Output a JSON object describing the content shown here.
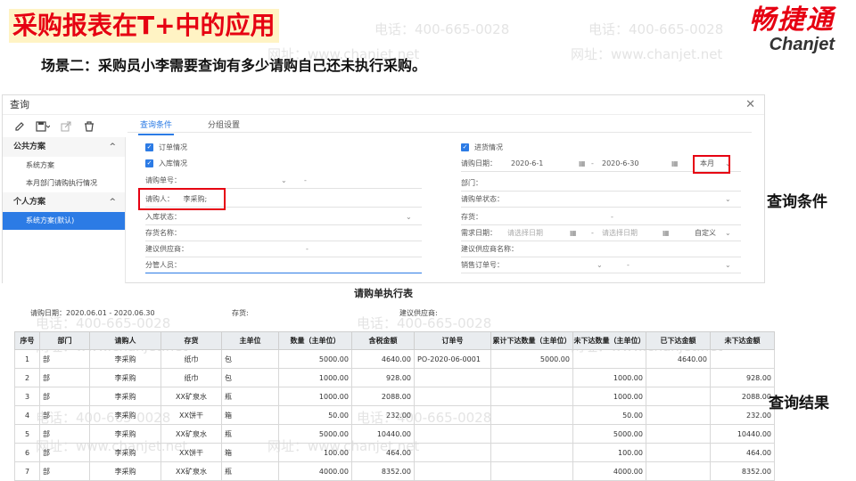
{
  "slide": {
    "title": "采购报表在T+中的应用",
    "scenario": "场景二：采购员小李需要查询有多少请购自己还未执行采购。",
    "label_conditions": "查询条件",
    "label_results": "查询结果"
  },
  "brand": {
    "cn": "畅捷通",
    "en": "Chanjet"
  },
  "watermark": {
    "phone": "电话：400-665-0028",
    "site": "网址：www.chanjet.net"
  },
  "window": {
    "title": "查询",
    "toolbar_icons": [
      "edit-icon",
      "save-icon",
      "export-icon",
      "delete-icon"
    ],
    "left_panel": {
      "public_header": "公共方案",
      "public_items": [
        "系统方案",
        "本月部门请购执行情况"
      ],
      "personal_header": "个人方案",
      "personal_items": [
        "系统方案(默认)"
      ]
    },
    "tabs": [
      "查询条件",
      "分组设置"
    ],
    "form_left": {
      "order_check": "订单情况",
      "stock_check": "入库情况",
      "req_no": "请购单号：",
      "req_person_label": "请购人：",
      "req_person_value": "李采购;",
      "stock_status": "入库状态：",
      "inventory_name": "存货名称：",
      "suggest_supplier": "建议供应商：",
      "manager": "分管人员："
    },
    "form_right": {
      "arrival_check": "进货情况",
      "req_date_label": "请购日期：",
      "date_from": "2020-6-1",
      "date_to": "2020-6-30",
      "period": "本月",
      "dept": "部门：",
      "req_status": "请购单状态：",
      "inventory": "存货：",
      "need_date_label": "需求日期：",
      "need_date_placeholder": "请选择日期",
      "custom": "自定义",
      "supplier_name": "建议供应商名称：",
      "sales_order": "销售订单号："
    }
  },
  "report": {
    "title": "请购单执行表",
    "meta_date": "请购日期：2020.06.01 - 2020.06.30",
    "meta_inventory": "存货:",
    "meta_supplier": "建议供应商:",
    "columns": [
      "序号",
      "部门",
      "请购人",
      "存货",
      "主单位",
      "数量（主单位）",
      "含税金额",
      "订单号",
      "累计下达数量（主单位）",
      "未下达数量（主单位）",
      "已下达金额",
      "未下达金额"
    ],
    "rows": [
      [
        "1",
        "部",
        "李采购",
        "纸巾",
        "包",
        "5000.00",
        "4640.00",
        "PO-2020-06-0001",
        "5000.00",
        "",
        "4640.00",
        ""
      ],
      [
        "2",
        "部",
        "李采购",
        "纸巾",
        "包",
        "1000.00",
        "928.00",
        "",
        "",
        "1000.00",
        "",
        "928.00"
      ],
      [
        "3",
        "部",
        "李采购",
        "XX矿泉水",
        "瓶",
        "1000.00",
        "2088.00",
        "",
        "",
        "1000.00",
        "",
        "2088.00"
      ],
      [
        "4",
        "部",
        "李采购",
        "XX饼干",
        "箱",
        "50.00",
        "232.00",
        "",
        "",
        "50.00",
        "",
        "232.00"
      ],
      [
        "5",
        "部",
        "李采购",
        "XX矿泉水",
        "瓶",
        "5000.00",
        "10440.00",
        "",
        "",
        "5000.00",
        "",
        "10440.00"
      ],
      [
        "6",
        "部",
        "李采购",
        "XX饼干",
        "箱",
        "100.00",
        "464.00",
        "",
        "",
        "100.00",
        "",
        "464.00"
      ],
      [
        "7",
        "部",
        "李采购",
        "XX矿泉水",
        "瓶",
        "4000.00",
        "8352.00",
        "",
        "",
        "4000.00",
        "",
        "8352.00"
      ]
    ]
  }
}
